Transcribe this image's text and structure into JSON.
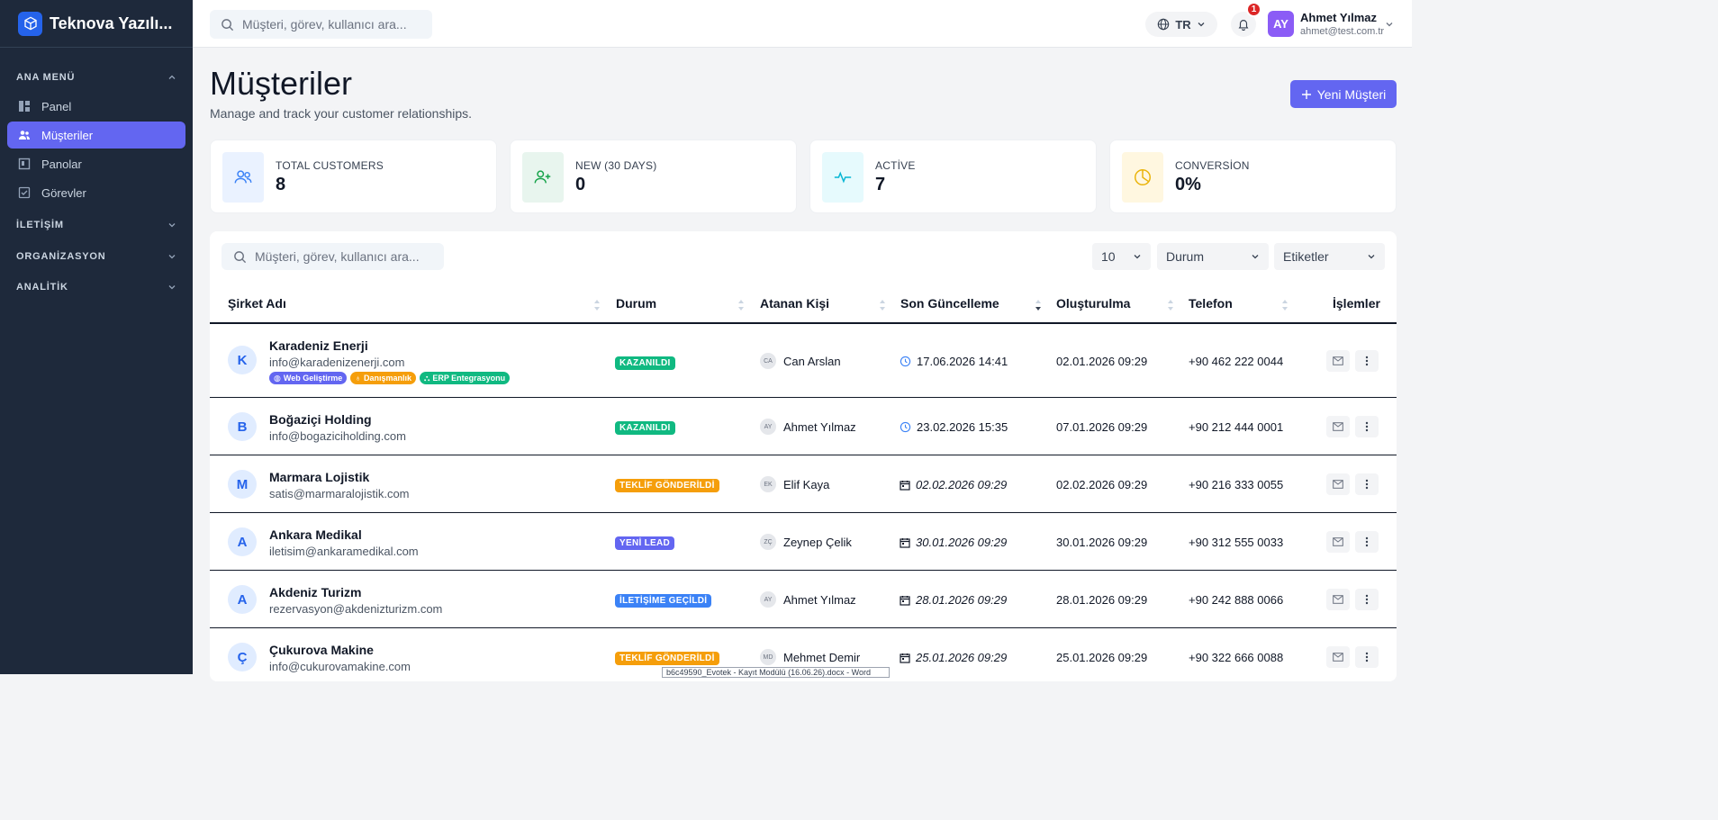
{
  "app": {
    "brand": "Teknova Yazılı..."
  },
  "sidebar": {
    "sections": [
      {
        "label": "ANA MENÜ"
      },
      {
        "label": "İLETİŞİM"
      },
      {
        "label": "ORGANİZASYON"
      },
      {
        "label": "ANALİTİK"
      }
    ],
    "items": [
      {
        "label": "Panel",
        "icon": "dashboard-icon"
      },
      {
        "label": "Müşteriler",
        "icon": "users-icon",
        "active": true
      },
      {
        "label": "Panolar",
        "icon": "board-icon"
      },
      {
        "label": "Görevler",
        "icon": "task-check-icon"
      }
    ]
  },
  "header": {
    "search_placeholder": "Müşteri, görev, kullanıcı ara...",
    "lang": "TR",
    "notification_count": "1",
    "user": {
      "initials": "AY",
      "name": "Ahmet Yılmaz",
      "email": "ahmet@test.com.tr"
    }
  },
  "page": {
    "title": "Müşteriler",
    "subtitle": "Manage and track your customer relationships.",
    "new_button": "Yeni Müşteri"
  },
  "stats": [
    {
      "label": "TOTAL CUSTOMERS",
      "value": "8",
      "icon": "users-icon",
      "color": "#3b82f6",
      "bg": "#eaf2ff"
    },
    {
      "label": "NEW (30 DAYS)",
      "value": "0",
      "icon": "user-plus-icon",
      "color": "#16a34a",
      "bg": "#e8f5ee"
    },
    {
      "label": "ACTİVE",
      "value": "7",
      "icon": "activity-icon",
      "color": "#06b6d4",
      "bg": "#e6fafd"
    },
    {
      "label": "CONVERSİON",
      "value": "0%",
      "icon": "pie-chart-icon",
      "color": "#eab308",
      "bg": "#fff7e0"
    }
  ],
  "table": {
    "search_placeholder": "Müşteri, görev, kullanıcı ara...",
    "page_size": "10",
    "filter_status": "Durum",
    "filter_tags": "Etiketler",
    "columns": [
      "Şirket Adı",
      "Durum",
      "Atanan Kişi",
      "Son Güncelleme",
      "Oluşturulma",
      "Telefon",
      "İşlemler"
    ],
    "rows": [
      {
        "initial": "K",
        "name": "Karadeniz Enerji",
        "email": "info@karadenizenerji.com",
        "status": "KAZANILDI",
        "status_color": "#10b981",
        "assignee_initials": "CA",
        "assignee": "Can Arslan",
        "updated": "17.06.2026 14:41",
        "updated_icon": "clock-icon",
        "created": "02.01.2026 09:29",
        "phone": "+90 462 222 0044",
        "tags": [
          {
            "label": "Web Geliştirme",
            "color": "#6366f1"
          },
          {
            "label": "Danışmanlık",
            "color": "#f59e0b"
          },
          {
            "label": "ERP Entegrasyonu",
            "color": "#10b981"
          }
        ]
      },
      {
        "initial": "B",
        "name": "Boğaziçi Holding",
        "email": "info@bogaziciholding.com",
        "status": "KAZANILDI",
        "status_color": "#10b981",
        "assignee_initials": "AY",
        "assignee": "Ahmet Yılmaz",
        "updated": "23.02.2026 15:35",
        "updated_icon": "clock-icon",
        "created": "07.01.2026 09:29",
        "phone": "+90 212 444 0001"
      },
      {
        "initial": "M",
        "name": "Marmara Lojistik",
        "email": "satis@marmaralojistik.com",
        "status": "TEKLİF GÖNDERİLDİ",
        "status_color": "#f59e0b",
        "assignee_initials": "EK",
        "assignee": "Elif Kaya",
        "updated": "02.02.2026 09:29",
        "updated_icon": "calendar-icon",
        "created": "02.02.2026 09:29",
        "phone": "+90 216 333 0055"
      },
      {
        "initial": "A",
        "name": "Ankara Medikal",
        "email": "iletisim@ankaramedikal.com",
        "status": "YENİ LEAD",
        "status_color": "#6366f1",
        "assignee_initials": "ZÇ",
        "assignee": "Zeynep Çelik",
        "updated": "30.01.2026 09:29",
        "updated_icon": "calendar-icon",
        "created": "30.01.2026 09:29",
        "phone": "+90 312 555 0033"
      },
      {
        "initial": "A",
        "name": "Akdeniz Turizm",
        "email": "rezervasyon@akdenizturizm.com",
        "status": "İLETİŞİME GEÇİLDİ",
        "status_color": "#3b82f6",
        "assignee_initials": "AY",
        "assignee": "Ahmet Yılmaz",
        "updated": "28.01.2026 09:29",
        "updated_icon": "calendar-icon",
        "created": "28.01.2026 09:29",
        "phone": "+90 242 888 0066"
      },
      {
        "initial": "Ç",
        "name": "Çukurova Makine",
        "email": "info@cukurovamakine.com",
        "status": "TEKLİF GÖNDERİLDİ",
        "status_color": "#f59e0b",
        "assignee_initials": "MD",
        "assignee": "Mehmet Demir",
        "updated": "25.01.2026 09:29",
        "updated_icon": "calendar-icon",
        "created": "25.01.2026 09:29",
        "phone": "+90 322 666 0088"
      }
    ]
  },
  "tooltip": "b6c49590_Evotek - Kayıt Modülü (16.06.26).docx - Word"
}
